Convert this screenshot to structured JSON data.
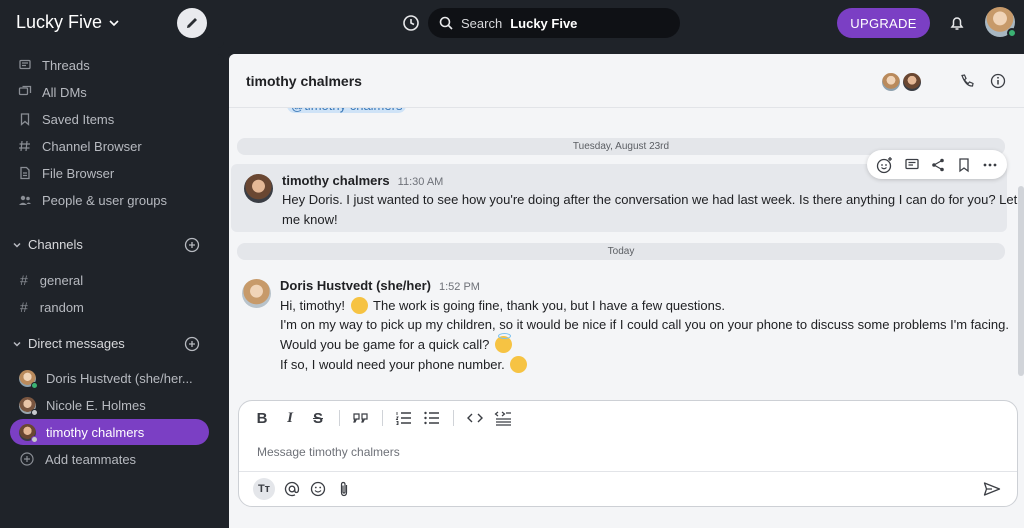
{
  "workspace": {
    "name": "Lucky Five"
  },
  "topbar": {
    "search_label": "Search",
    "search_scope": "Lucky Five",
    "upgrade_label": "UPGRADE"
  },
  "sidebar": {
    "nav": [
      {
        "label": "Threads",
        "icon": "threads-icon"
      },
      {
        "label": "All DMs",
        "icon": "all-dms-icon"
      },
      {
        "label": "Saved Items",
        "icon": "bookmark-icon"
      },
      {
        "label": "Channel Browser",
        "icon": "channel-browser-icon"
      },
      {
        "label": "File Browser",
        "icon": "file-icon"
      },
      {
        "label": "People & user groups",
        "icon": "people-icon"
      }
    ],
    "channels_title": "Channels",
    "channels": [
      "general",
      "random"
    ],
    "dms_title": "Direct messages",
    "dms": [
      {
        "label": "Doris Hustvedt (she/her...",
        "status_color": "#3bb273"
      },
      {
        "label": "Nicole E. Holmes",
        "status_color": "#c7c9cd"
      },
      {
        "label": "timothy chalmers",
        "status_color": "#c7c9cd",
        "active": true
      }
    ],
    "add_teammates": "Add teammates"
  },
  "channel": {
    "title": "timothy chalmers",
    "mention_fragment": "@timothy chalmers"
  },
  "date_dividers": [
    "Tuesday, August 23rd",
    "Today"
  ],
  "messages": [
    {
      "author": "timothy chalmers",
      "time": "11:30 AM",
      "lines": [
        "Hey Doris. I just wanted to see how you're doing after the conversation we had last week. Is there anything I can do for you? Let",
        "me know!"
      ]
    },
    {
      "author": "Doris Hustvedt (she/her)",
      "time": "1:52 PM",
      "lines": [
        "Hi, timothy!",
        "The work is going fine, thank you, but I have a few questions.",
        "I'm on my way to pick up my children, so it would be nice if I could call you on your phone to discuss some problems I'm facing.",
        "Would you be game for a quick call?",
        "If so, I would need your phone number."
      ]
    }
  ],
  "composer": {
    "placeholder": "Message timothy chalmers"
  },
  "colors": {
    "accent": "#7b3fc4",
    "sidebar_bg": "#1f2329",
    "online": "#3bb273"
  }
}
